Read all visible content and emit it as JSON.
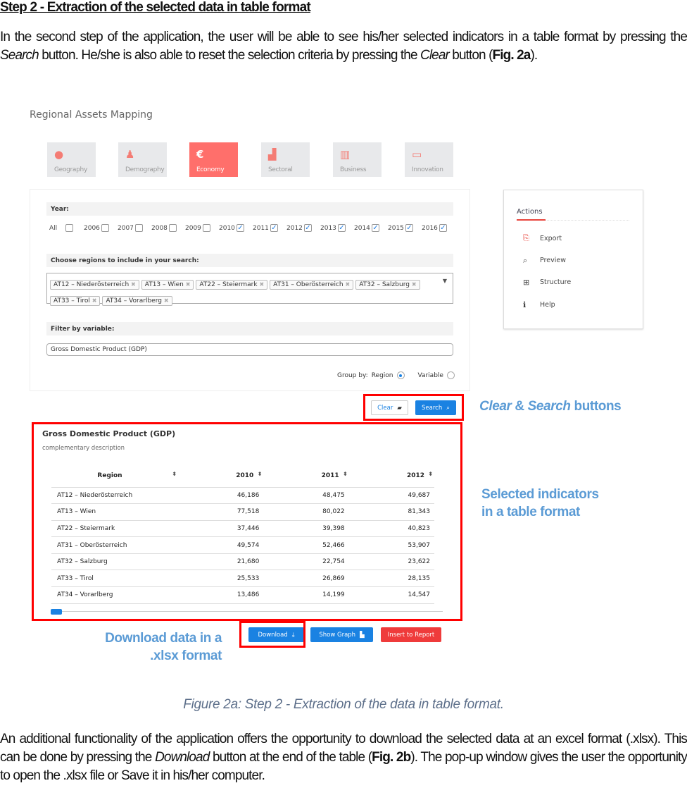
{
  "heading": "Step 2 -  Extraction of the selected data in table format",
  "intro": {
    "p1": "In the second step of the application, the user will be able to see his/her selected indicators in a table format by pressing the ",
    "search": "Search",
    "p2": " button.  He/she is also able to reset the selection criteria by pressing the ",
    "clear": "Clear",
    "p3": " button (",
    "fig": "Fig. 2a",
    "p4": ")."
  },
  "app": {
    "title": "Regional Assets Mapping",
    "tiles": [
      {
        "label": "Geography",
        "icon": "globe-icon"
      },
      {
        "label": "Demography",
        "icon": "person-icon"
      },
      {
        "label": "Economy",
        "icon": "euro-icon",
        "active": true
      },
      {
        "label": "Sectoral",
        "icon": "factory-icon"
      },
      {
        "label": "Business",
        "icon": "building-icon"
      },
      {
        "label": "Innovation",
        "icon": "laptop-icon"
      }
    ],
    "year_label": "Year:",
    "years": [
      {
        "label": "All",
        "checked": false
      },
      {
        "label": "2006",
        "checked": false
      },
      {
        "label": "2007",
        "checked": false
      },
      {
        "label": "2008",
        "checked": false
      },
      {
        "label": "2009",
        "checked": false
      },
      {
        "label": "2010",
        "checked": true
      },
      {
        "label": "2011",
        "checked": true
      },
      {
        "label": "2012",
        "checked": true
      },
      {
        "label": "2013",
        "checked": true
      },
      {
        "label": "2014",
        "checked": true
      },
      {
        "label": "2015",
        "checked": true
      },
      {
        "label": "2016",
        "checked": true
      }
    ],
    "regions_label": "Choose regions to include in your search:",
    "regions": [
      "AT12 – Niederösterreich",
      "AT13 – Wien",
      "AT22 – Steiermark",
      "AT31 – Oberösterreich",
      "AT32 – Salzburg",
      "AT33 – Tirol",
      "AT34 – Vorarlberg"
    ],
    "filter_label": "Filter by variable:",
    "filter_value": "Gross Domestic Product (GDP)",
    "group_by": {
      "label": "Group by:",
      "region": "Region",
      "variable": "Variable",
      "selected": "Region"
    },
    "actions": {
      "title": "Actions",
      "items": [
        {
          "label": "Export",
          "icon": "export-icon"
        },
        {
          "label": "Preview",
          "icon": "preview-icon"
        },
        {
          "label": "Structure",
          "icon": "structure-icon"
        },
        {
          "label": "Help",
          "icon": "info-icon"
        }
      ]
    },
    "clear_label": "Clear",
    "search_label": "Search",
    "table": {
      "title": "Gross Domestic Product (GDP)",
      "description": "complementary description",
      "columns": [
        "Region",
        "2010",
        "2011",
        "2012"
      ],
      "rows": [
        [
          "AT12 – Niederösterreich",
          "46,186",
          "48,475",
          "49,687"
        ],
        [
          "AT13 – Wien",
          "77,518",
          "80,022",
          "81,343"
        ],
        [
          "AT22 – Steiermark",
          "37,446",
          "39,398",
          "40,823"
        ],
        [
          "AT31 – Oberösterreich",
          "49,574",
          "52,466",
          "53,907"
        ],
        [
          "AT32 – Salzburg",
          "21,680",
          "22,754",
          "23,622"
        ],
        [
          "AT33 – Tirol",
          "25,533",
          "26,869",
          "28,135"
        ],
        [
          "AT34 – Vorarlberg",
          "13,486",
          "14,199",
          "14,547"
        ]
      ]
    },
    "download_label": "Download",
    "show_graph_label": "Show Graph",
    "insert_label": "Insert to Report"
  },
  "annotations": {
    "clear": "Clear",
    "amp": " & ",
    "search": "Search",
    "buttons": " buttons",
    "table_1": "Selected indicators",
    "table_2": "in a table format",
    "download_1": "Download data in a",
    "download_2": ".xlsx format"
  },
  "caption": "Figure 2a:  Step 2 - Extraction of the data in table format.",
  "outro": {
    "p1": "An additional functionality of the application offers the opportunity to download the selected data at an excel format (.xlsx). This can be done by pressing the ",
    "download": "Download",
    "p2": " button at the end of the table (",
    "fig": "Fig. 2b",
    "p3": "). The pop-up window gives the user the opportunity to open the .xlsx file or Save it in his/her computer."
  }
}
